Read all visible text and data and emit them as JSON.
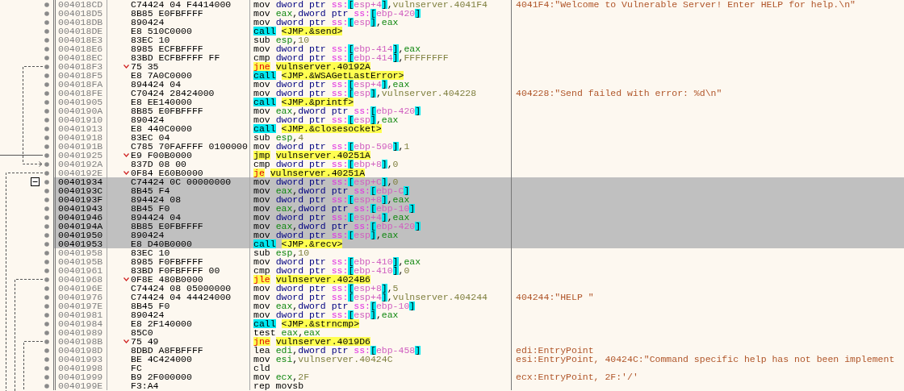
{
  "rows": [
    {
      "address": "004018CD",
      "bytes": "C74424 04 F4414000",
      "jump": false,
      "fold": false,
      "selected": false,
      "mnemonic": "mov",
      "kind": "plain",
      "operands": [
        {
          "kind": "size",
          "text": "dword ptr"
        },
        {
          "kind": "seg",
          "text": "ss:"
        },
        {
          "kind": "brk",
          "text": "["
        },
        {
          "kind": "mem",
          "text": "esp+4"
        },
        {
          "kind": "brk",
          "text": "]"
        },
        {
          "kind": "txt",
          "text": ","
        },
        {
          "kind": "num",
          "text": "vulnserver.4041F4"
        }
      ],
      "comment": "4041F4:\"Welcome to Vulnerable Server! Enter HELP for help.\\n\""
    },
    {
      "address": "004018D5",
      "bytes": "8B85 E0FBFFFF",
      "jump": false,
      "fold": false,
      "selected": false,
      "mnemonic": "mov",
      "kind": "plain",
      "operands": [
        {
          "kind": "reg",
          "text": "eax"
        },
        {
          "kind": "txt",
          "text": ","
        },
        {
          "kind": "size",
          "text": "dword ptr"
        },
        {
          "kind": "seg",
          "text": "ss:"
        },
        {
          "kind": "brk",
          "text": "["
        },
        {
          "kind": "mem",
          "text": "ebp-420"
        },
        {
          "kind": "brk",
          "text": "]"
        }
      ]
    },
    {
      "address": "004018DB",
      "bytes": "890424",
      "jump": false,
      "fold": false,
      "selected": false,
      "mnemonic": "mov",
      "kind": "plain",
      "operands": [
        {
          "kind": "size",
          "text": "dword ptr"
        },
        {
          "kind": "seg",
          "text": "ss:"
        },
        {
          "kind": "brk",
          "text": "["
        },
        {
          "kind": "mem",
          "text": "esp"
        },
        {
          "kind": "brk",
          "text": "]"
        },
        {
          "kind": "txt",
          "text": ","
        },
        {
          "kind": "reg",
          "text": "eax"
        }
      ]
    },
    {
      "address": "004018DE",
      "bytes": "E8 510C0000",
      "jump": false,
      "fold": false,
      "selected": false,
      "mnemonic": "call",
      "kind": "call",
      "operands": [
        {
          "kind": "tgt",
          "text": "<JMP.&send>"
        }
      ]
    },
    {
      "address": "004018E3",
      "bytes": "83EC 10",
      "jump": false,
      "fold": false,
      "selected": false,
      "mnemonic": "sub",
      "kind": "plain",
      "operands": [
        {
          "kind": "reg",
          "text": "esp"
        },
        {
          "kind": "txt",
          "text": ","
        },
        {
          "kind": "num",
          "text": "10"
        }
      ]
    },
    {
      "address": "004018E6",
      "bytes": "8985 ECFBFFFF",
      "jump": false,
      "fold": false,
      "selected": false,
      "mnemonic": "mov",
      "kind": "plain",
      "operands": [
        {
          "kind": "size",
          "text": "dword ptr"
        },
        {
          "kind": "seg",
          "text": "ss:"
        },
        {
          "kind": "brk",
          "text": "["
        },
        {
          "kind": "mem",
          "text": "ebp-414"
        },
        {
          "kind": "brk",
          "text": "]"
        },
        {
          "kind": "txt",
          "text": ","
        },
        {
          "kind": "reg",
          "text": "eax"
        }
      ]
    },
    {
      "address": "004018EC",
      "bytes": "83BD ECFBFFFF FF",
      "jump": false,
      "fold": false,
      "selected": false,
      "mnemonic": "cmp",
      "kind": "plain",
      "operands": [
        {
          "kind": "size",
          "text": "dword ptr"
        },
        {
          "kind": "seg",
          "text": "ss:"
        },
        {
          "kind": "brk",
          "text": "["
        },
        {
          "kind": "mem",
          "text": "ebp-414"
        },
        {
          "kind": "brk",
          "text": "]"
        },
        {
          "kind": "txt",
          "text": ","
        },
        {
          "kind": "num",
          "text": "FFFFFFFF"
        }
      ]
    },
    {
      "address": "004018F3",
      "bytes": "75 35",
      "jump": true,
      "fold": false,
      "selected": false,
      "mnemonic": "jne",
      "kind": "jcc",
      "operands": [
        {
          "kind": "tgt",
          "text": "vulnserver.40192A"
        }
      ]
    },
    {
      "address": "004018F5",
      "bytes": "E8 7A0C0000",
      "jump": false,
      "fold": false,
      "selected": false,
      "mnemonic": "call",
      "kind": "call",
      "operands": [
        {
          "kind": "tgt",
          "text": "<JMP.&WSAGetLastError>"
        }
      ]
    },
    {
      "address": "004018FA",
      "bytes": "894424 04",
      "jump": false,
      "fold": false,
      "selected": false,
      "mnemonic": "mov",
      "kind": "plain",
      "operands": [
        {
          "kind": "size",
          "text": "dword ptr"
        },
        {
          "kind": "seg",
          "text": "ss:"
        },
        {
          "kind": "brk",
          "text": "["
        },
        {
          "kind": "mem",
          "text": "esp+4"
        },
        {
          "kind": "brk",
          "text": "]"
        },
        {
          "kind": "txt",
          "text": ","
        },
        {
          "kind": "reg",
          "text": "eax"
        }
      ]
    },
    {
      "address": "004018FE",
      "bytes": "C70424 28424000",
      "jump": false,
      "fold": false,
      "selected": false,
      "mnemonic": "mov",
      "kind": "plain",
      "operands": [
        {
          "kind": "size",
          "text": "dword ptr"
        },
        {
          "kind": "seg",
          "text": "ss:"
        },
        {
          "kind": "brk",
          "text": "["
        },
        {
          "kind": "mem",
          "text": "esp"
        },
        {
          "kind": "brk",
          "text": "]"
        },
        {
          "kind": "txt",
          "text": ","
        },
        {
          "kind": "num",
          "text": "vulnserver.404228"
        }
      ],
      "comment": "404228:\"Send failed with error: %d\\n\""
    },
    {
      "address": "00401905",
      "bytes": "E8 EE140000",
      "jump": false,
      "fold": false,
      "selected": false,
      "mnemonic": "call",
      "kind": "call",
      "operands": [
        {
          "kind": "tgt",
          "text": "<JMP.&printf>"
        }
      ]
    },
    {
      "address": "0040190A",
      "bytes": "8B85 E0FBFFFF",
      "jump": false,
      "fold": false,
      "selected": false,
      "mnemonic": "mov",
      "kind": "plain",
      "operands": [
        {
          "kind": "reg",
          "text": "eax"
        },
        {
          "kind": "txt",
          "text": ","
        },
        {
          "kind": "size",
          "text": "dword ptr"
        },
        {
          "kind": "seg",
          "text": "ss:"
        },
        {
          "kind": "brk",
          "text": "["
        },
        {
          "kind": "mem",
          "text": "ebp-420"
        },
        {
          "kind": "brk",
          "text": "]"
        }
      ]
    },
    {
      "address": "00401910",
      "bytes": "890424",
      "jump": false,
      "fold": false,
      "selected": false,
      "mnemonic": "mov",
      "kind": "plain",
      "operands": [
        {
          "kind": "size",
          "text": "dword ptr"
        },
        {
          "kind": "seg",
          "text": "ss:"
        },
        {
          "kind": "brk",
          "text": "["
        },
        {
          "kind": "mem",
          "text": "esp"
        },
        {
          "kind": "brk",
          "text": "]"
        },
        {
          "kind": "txt",
          "text": ","
        },
        {
          "kind": "reg",
          "text": "eax"
        }
      ]
    },
    {
      "address": "00401913",
      "bytes": "E8 440C0000",
      "jump": false,
      "fold": false,
      "selected": false,
      "mnemonic": "call",
      "kind": "call",
      "operands": [
        {
          "kind": "tgt",
          "text": "<JMP.&closesocket>"
        }
      ]
    },
    {
      "address": "00401918",
      "bytes": "83EC 04",
      "jump": false,
      "fold": false,
      "selected": false,
      "mnemonic": "sub",
      "kind": "plain",
      "operands": [
        {
          "kind": "reg",
          "text": "esp"
        },
        {
          "kind": "txt",
          "text": ","
        },
        {
          "kind": "num",
          "text": "4"
        }
      ]
    },
    {
      "address": "0040191B",
      "bytes": "C785 70FAFFFF 0100000",
      "jump": false,
      "fold": false,
      "selected": false,
      "mnemonic": "mov",
      "kind": "plain",
      "operands": [
        {
          "kind": "size",
          "text": "dword ptr"
        },
        {
          "kind": "seg",
          "text": "ss:"
        },
        {
          "kind": "brk",
          "text": "["
        },
        {
          "kind": "mem",
          "text": "ebp-590"
        },
        {
          "kind": "brk",
          "text": "]"
        },
        {
          "kind": "txt",
          "text": ","
        },
        {
          "kind": "num",
          "text": "1"
        }
      ]
    },
    {
      "address": "00401925",
      "bytes": "E9 F00B0000",
      "jump": true,
      "fold": false,
      "selected": false,
      "mnemonic": "jmp",
      "kind": "jmp",
      "operands": [
        {
          "kind": "tgt",
          "text": "vulnserver.40251A"
        }
      ]
    },
    {
      "address": "0040192A",
      "bytes": "837D 08 00",
      "jump": false,
      "fold": false,
      "selected": false,
      "mnemonic": "cmp",
      "kind": "plain",
      "operands": [
        {
          "kind": "size",
          "text": "dword ptr"
        },
        {
          "kind": "seg",
          "text": "ss:"
        },
        {
          "kind": "brk",
          "text": "["
        },
        {
          "kind": "mem",
          "text": "ebp+8"
        },
        {
          "kind": "brk",
          "text": "]"
        },
        {
          "kind": "txt",
          "text": ","
        },
        {
          "kind": "num",
          "text": "0"
        }
      ]
    },
    {
      "address": "0040192E",
      "bytes": "0F84 E60B0000",
      "jump": true,
      "fold": false,
      "selected": false,
      "mnemonic": "je",
      "kind": "jcc",
      "operands": [
        {
          "kind": "tgt",
          "text": "vulnserver.40251A"
        }
      ]
    },
    {
      "address": "00401934",
      "bytes": "C74424 0C 00000000",
      "jump": false,
      "fold": true,
      "selected": true,
      "mnemonic": "mov",
      "kind": "plain",
      "operands": [
        {
          "kind": "size",
          "text": "dword ptr"
        },
        {
          "kind": "seg",
          "text": "ss:"
        },
        {
          "kind": "brk",
          "text": "["
        },
        {
          "kind": "mem",
          "text": "esp+C"
        },
        {
          "kind": "brk",
          "text": "]"
        },
        {
          "kind": "txt",
          "text": ","
        },
        {
          "kind": "num",
          "text": "0"
        }
      ]
    },
    {
      "address": "0040193C",
      "bytes": "8B45 F4",
      "jump": false,
      "fold": false,
      "selected": true,
      "mnemonic": "mov",
      "kind": "plain",
      "operands": [
        {
          "kind": "reg",
          "text": "eax"
        },
        {
          "kind": "txt",
          "text": ","
        },
        {
          "kind": "size",
          "text": "dword ptr"
        },
        {
          "kind": "seg",
          "text": "ss:"
        },
        {
          "kind": "brk",
          "text": "["
        },
        {
          "kind": "mem",
          "text": "ebp-C"
        },
        {
          "kind": "brk",
          "text": "]"
        }
      ]
    },
    {
      "address": "0040193F",
      "bytes": "894424 08",
      "jump": false,
      "fold": false,
      "selected": true,
      "mnemonic": "mov",
      "kind": "plain",
      "operands": [
        {
          "kind": "size",
          "text": "dword ptr"
        },
        {
          "kind": "seg",
          "text": "ss:"
        },
        {
          "kind": "brk",
          "text": "["
        },
        {
          "kind": "mem",
          "text": "esp+8"
        },
        {
          "kind": "brk",
          "text": "]"
        },
        {
          "kind": "txt",
          "text": ","
        },
        {
          "kind": "reg",
          "text": "eax"
        }
      ]
    },
    {
      "address": "00401943",
      "bytes": "8B45 F0",
      "jump": false,
      "fold": false,
      "selected": true,
      "mnemonic": "mov",
      "kind": "plain",
      "operands": [
        {
          "kind": "reg",
          "text": "eax"
        },
        {
          "kind": "txt",
          "text": ","
        },
        {
          "kind": "size",
          "text": "dword ptr"
        },
        {
          "kind": "seg",
          "text": "ss:"
        },
        {
          "kind": "brk",
          "text": "["
        },
        {
          "kind": "mem",
          "text": "ebp-10"
        },
        {
          "kind": "brk",
          "text": "]"
        }
      ]
    },
    {
      "address": "00401946",
      "bytes": "894424 04",
      "jump": false,
      "fold": false,
      "selected": true,
      "mnemonic": "mov",
      "kind": "plain",
      "operands": [
        {
          "kind": "size",
          "text": "dword ptr"
        },
        {
          "kind": "seg",
          "text": "ss:"
        },
        {
          "kind": "brk",
          "text": "["
        },
        {
          "kind": "mem",
          "text": "esp+4"
        },
        {
          "kind": "brk",
          "text": "]"
        },
        {
          "kind": "txt",
          "text": ","
        },
        {
          "kind": "reg",
          "text": "eax"
        }
      ]
    },
    {
      "address": "0040194A",
      "bytes": "8B85 E0FBFFFF",
      "jump": false,
      "fold": false,
      "selected": true,
      "mnemonic": "mov",
      "kind": "plain",
      "operands": [
        {
          "kind": "reg",
          "text": "eax"
        },
        {
          "kind": "txt",
          "text": ","
        },
        {
          "kind": "size",
          "text": "dword ptr"
        },
        {
          "kind": "seg",
          "text": "ss:"
        },
        {
          "kind": "brk",
          "text": "["
        },
        {
          "kind": "mem",
          "text": "ebp-420"
        },
        {
          "kind": "brk",
          "text": "]"
        }
      ]
    },
    {
      "address": "00401950",
      "bytes": "890424",
      "jump": false,
      "fold": false,
      "selected": true,
      "mnemonic": "mov",
      "kind": "plain",
      "operands": [
        {
          "kind": "size",
          "text": "dword ptr"
        },
        {
          "kind": "seg",
          "text": "ss:"
        },
        {
          "kind": "brk",
          "text": "["
        },
        {
          "kind": "mem",
          "text": "esp"
        },
        {
          "kind": "brk",
          "text": "]"
        },
        {
          "kind": "txt",
          "text": ","
        },
        {
          "kind": "reg",
          "text": "eax"
        }
      ]
    },
    {
      "address": "00401953",
      "bytes": "E8 D40B0000",
      "jump": false,
      "fold": false,
      "selected": true,
      "mnemonic": "call",
      "kind": "call",
      "operands": [
        {
          "kind": "tgt",
          "text": "<JMP.&recv>"
        }
      ]
    },
    {
      "address": "00401958",
      "bytes": "83EC 10",
      "jump": false,
      "fold": false,
      "selected": false,
      "mnemonic": "sub",
      "kind": "plain",
      "operands": [
        {
          "kind": "reg",
          "text": "esp"
        },
        {
          "kind": "txt",
          "text": ","
        },
        {
          "kind": "num",
          "text": "10"
        }
      ]
    },
    {
      "address": "0040195B",
      "bytes": "8985 F0FBFFFF",
      "jump": false,
      "fold": false,
      "selected": false,
      "mnemonic": "mov",
      "kind": "plain",
      "operands": [
        {
          "kind": "size",
          "text": "dword ptr"
        },
        {
          "kind": "seg",
          "text": "ss:"
        },
        {
          "kind": "brk",
          "text": "["
        },
        {
          "kind": "mem",
          "text": "ebp-410"
        },
        {
          "kind": "brk",
          "text": "]"
        },
        {
          "kind": "txt",
          "text": ","
        },
        {
          "kind": "reg",
          "text": "eax"
        }
      ]
    },
    {
      "address": "00401961",
      "bytes": "83BD F0FBFFFF 00",
      "jump": false,
      "fold": false,
      "selected": false,
      "mnemonic": "cmp",
      "kind": "plain",
      "operands": [
        {
          "kind": "size",
          "text": "dword ptr"
        },
        {
          "kind": "seg",
          "text": "ss:"
        },
        {
          "kind": "brk",
          "text": "["
        },
        {
          "kind": "mem",
          "text": "ebp-410"
        },
        {
          "kind": "brk",
          "text": "]"
        },
        {
          "kind": "txt",
          "text": ","
        },
        {
          "kind": "num",
          "text": "0"
        }
      ]
    },
    {
      "address": "00401968",
      "bytes": "0F8E 480B0000",
      "jump": true,
      "fold": false,
      "selected": false,
      "mnemonic": "jle",
      "kind": "jcc",
      "operands": [
        {
          "kind": "tgt",
          "text": "vulnserver.4024B6"
        }
      ]
    },
    {
      "address": "0040196E",
      "bytes": "C74424 08 05000000",
      "jump": false,
      "fold": false,
      "selected": false,
      "mnemonic": "mov",
      "kind": "plain",
      "operands": [
        {
          "kind": "size",
          "text": "dword ptr"
        },
        {
          "kind": "seg",
          "text": "ss:"
        },
        {
          "kind": "brk",
          "text": "["
        },
        {
          "kind": "mem",
          "text": "esp+8"
        },
        {
          "kind": "brk",
          "text": "]"
        },
        {
          "kind": "txt",
          "text": ","
        },
        {
          "kind": "num",
          "text": "5"
        }
      ]
    },
    {
      "address": "00401976",
      "bytes": "C74424 04 44424000",
      "jump": false,
      "fold": false,
      "selected": false,
      "mnemonic": "mov",
      "kind": "plain",
      "operands": [
        {
          "kind": "size",
          "text": "dword ptr"
        },
        {
          "kind": "seg",
          "text": "ss:"
        },
        {
          "kind": "brk",
          "text": "["
        },
        {
          "kind": "mem",
          "text": "esp+4"
        },
        {
          "kind": "brk",
          "text": "]"
        },
        {
          "kind": "txt",
          "text": ","
        },
        {
          "kind": "num",
          "text": "vulnserver.404244"
        }
      ],
      "comment": "404244:\"HELP \""
    },
    {
      "address": "0040197E",
      "bytes": "8B45 F0",
      "jump": false,
      "fold": false,
      "selected": false,
      "mnemonic": "mov",
      "kind": "plain",
      "operands": [
        {
          "kind": "reg",
          "text": "eax"
        },
        {
          "kind": "txt",
          "text": ","
        },
        {
          "kind": "size",
          "text": "dword ptr"
        },
        {
          "kind": "seg",
          "text": "ss:"
        },
        {
          "kind": "brk",
          "text": "["
        },
        {
          "kind": "mem",
          "text": "ebp-10"
        },
        {
          "kind": "brk",
          "text": "]"
        }
      ]
    },
    {
      "address": "00401981",
      "bytes": "890424",
      "jump": false,
      "fold": false,
      "selected": false,
      "mnemonic": "mov",
      "kind": "plain",
      "operands": [
        {
          "kind": "size",
          "text": "dword ptr"
        },
        {
          "kind": "seg",
          "text": "ss:"
        },
        {
          "kind": "brk",
          "text": "["
        },
        {
          "kind": "mem",
          "text": "esp"
        },
        {
          "kind": "brk",
          "text": "]"
        },
        {
          "kind": "txt",
          "text": ","
        },
        {
          "kind": "reg",
          "text": "eax"
        }
      ]
    },
    {
      "address": "00401984",
      "bytes": "E8 2F140000",
      "jump": false,
      "fold": false,
      "selected": false,
      "mnemonic": "call",
      "kind": "call",
      "operands": [
        {
          "kind": "tgt",
          "text": "<JMP.&strncmp>"
        }
      ]
    },
    {
      "address": "00401989",
      "bytes": "85C0",
      "jump": false,
      "fold": false,
      "selected": false,
      "mnemonic": "test",
      "kind": "plain",
      "operands": [
        {
          "kind": "reg",
          "text": "eax"
        },
        {
          "kind": "txt",
          "text": ","
        },
        {
          "kind": "reg",
          "text": "eax"
        }
      ]
    },
    {
      "address": "0040198B",
      "bytes": "75 49",
      "jump": true,
      "fold": false,
      "selected": false,
      "mnemonic": "jne",
      "kind": "jcc",
      "operands": [
        {
          "kind": "tgt",
          "text": "vulnserver.4019D6"
        }
      ]
    },
    {
      "address": "0040198D",
      "bytes": "8DBD A8FBFFFF",
      "jump": false,
      "fold": false,
      "selected": false,
      "mnemonic": "lea",
      "kind": "plain",
      "operands": [
        {
          "kind": "reg",
          "text": "edi"
        },
        {
          "kind": "txt",
          "text": ","
        },
        {
          "kind": "size",
          "text": "dword ptr"
        },
        {
          "kind": "seg",
          "text": "ss:"
        },
        {
          "kind": "brk",
          "text": "["
        },
        {
          "kind": "mem",
          "text": "ebp-458"
        },
        {
          "kind": "brk",
          "text": "]"
        }
      ],
      "comment": "edi:EntryPoint"
    },
    {
      "address": "00401993",
      "bytes": "BE 4C424000",
      "jump": false,
      "fold": false,
      "selected": false,
      "mnemonic": "mov",
      "kind": "plain",
      "operands": [
        {
          "kind": "reg",
          "text": "esi"
        },
        {
          "kind": "txt",
          "text": ","
        },
        {
          "kind": "num",
          "text": "vulnserver.40424C"
        }
      ],
      "comment": "esi:EntryPoint, 40424C:\"Command specific help has not been implement"
    },
    {
      "address": "00401998",
      "bytes": "FC",
      "jump": false,
      "fold": false,
      "selected": false,
      "mnemonic": "cld",
      "kind": "plain"
    },
    {
      "address": "00401999",
      "bytes": "B9 2F000000",
      "jump": false,
      "fold": false,
      "selected": false,
      "mnemonic": "mov",
      "kind": "plain",
      "operands": [
        {
          "kind": "reg",
          "text": "ecx"
        },
        {
          "kind": "txt",
          "text": ","
        },
        {
          "kind": "num",
          "text": "2F"
        }
      ],
      "comment": "ecx:EntryPoint, 2F:'/'"
    },
    {
      "address": "0040199E",
      "bytes": "F3:A4",
      "jump": false,
      "fold": false,
      "selected": false,
      "mnemonic": "rep movsb",
      "kind": "plain"
    }
  ]
}
